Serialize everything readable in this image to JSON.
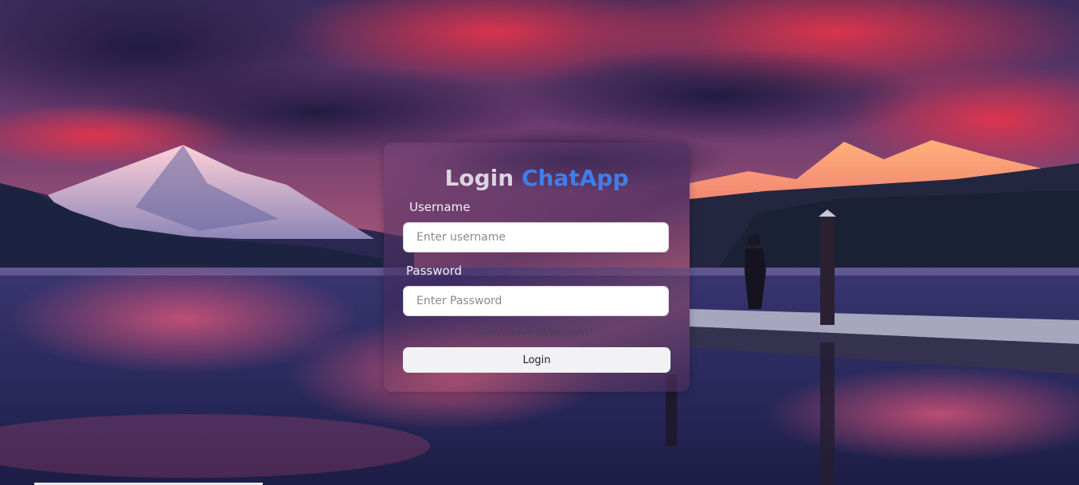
{
  "login_card": {
    "title_prefix": "Login",
    "title_brand": "ChatApp",
    "username_label": "Username",
    "username_placeholder": "Enter username",
    "password_label": "Password",
    "password_placeholder": "Enter Password",
    "register_link": "Don't have an account?",
    "login_button": "Login"
  },
  "colors": {
    "brand_accent": "#3f7ee8",
    "title_text": "#d9d4de",
    "input_background": "#ffffff",
    "button_background": "#f2f2f4"
  },
  "background": {
    "scene": "mountain lake at sunset"
  }
}
